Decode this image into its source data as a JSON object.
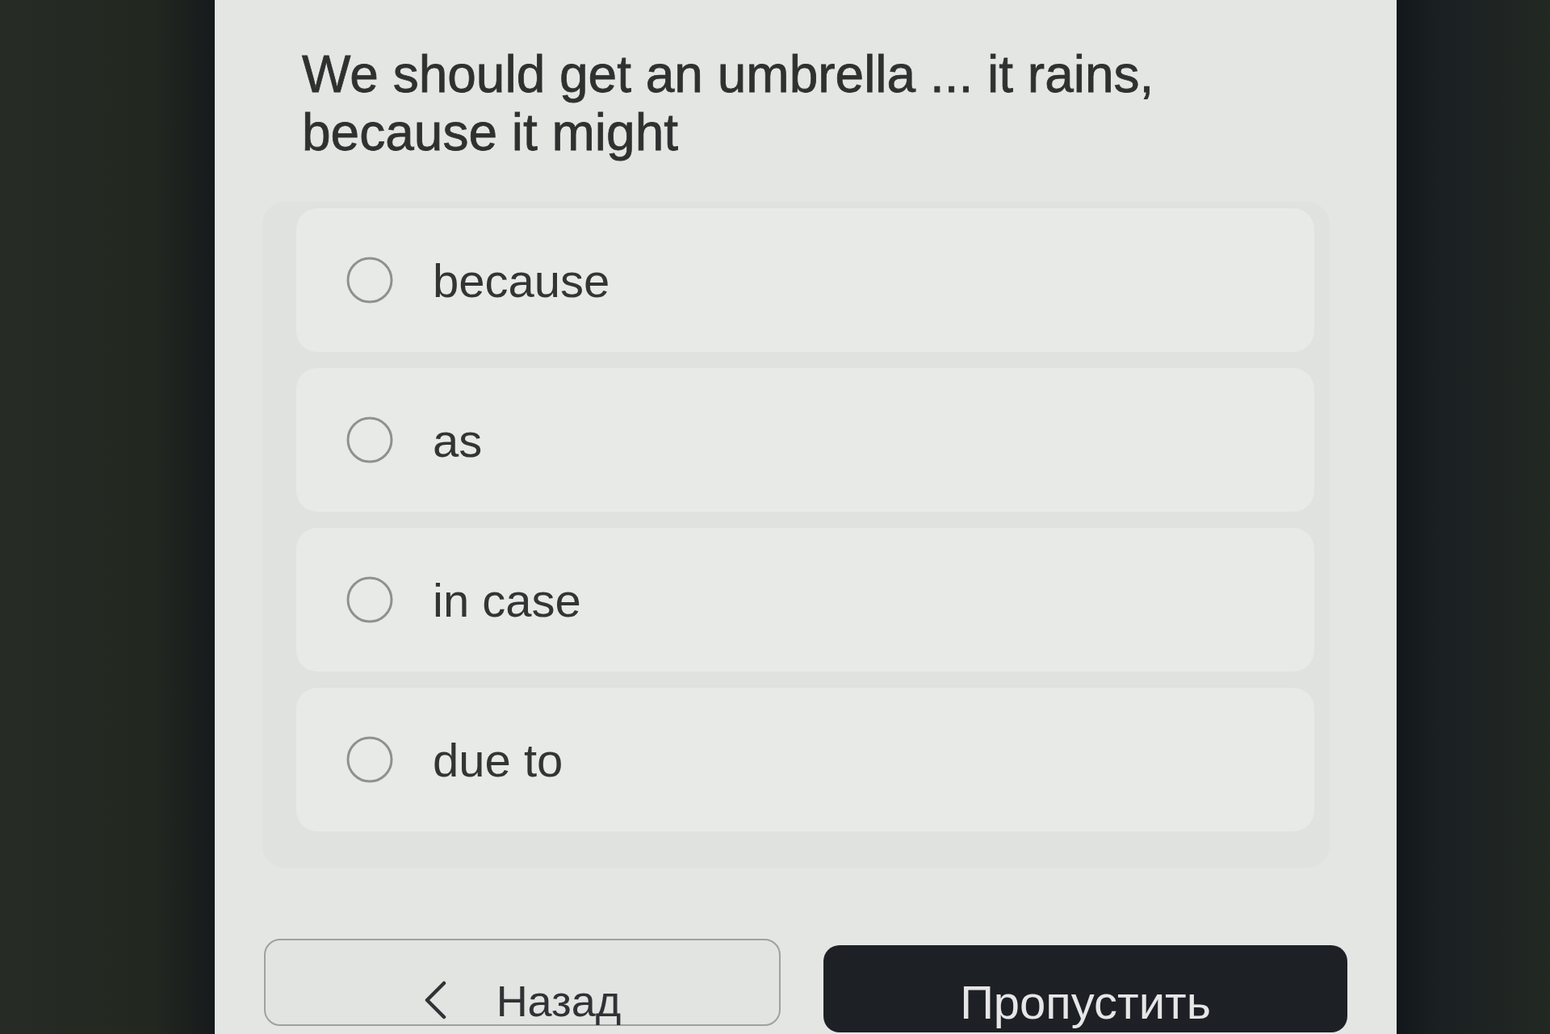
{
  "question": {
    "text": "We should get an umbrella ... it rains, because it might"
  },
  "options": [
    {
      "label": "because",
      "selected": false
    },
    {
      "label": "as",
      "selected": false
    },
    {
      "label": "in case",
      "selected": false
    },
    {
      "label": "due to",
      "selected": false
    }
  ],
  "buttons": [
    {
      "kind": "back",
      "label": "Назад"
    },
    {
      "kind": "skip",
      "label": "Пропустить"
    }
  ]
}
